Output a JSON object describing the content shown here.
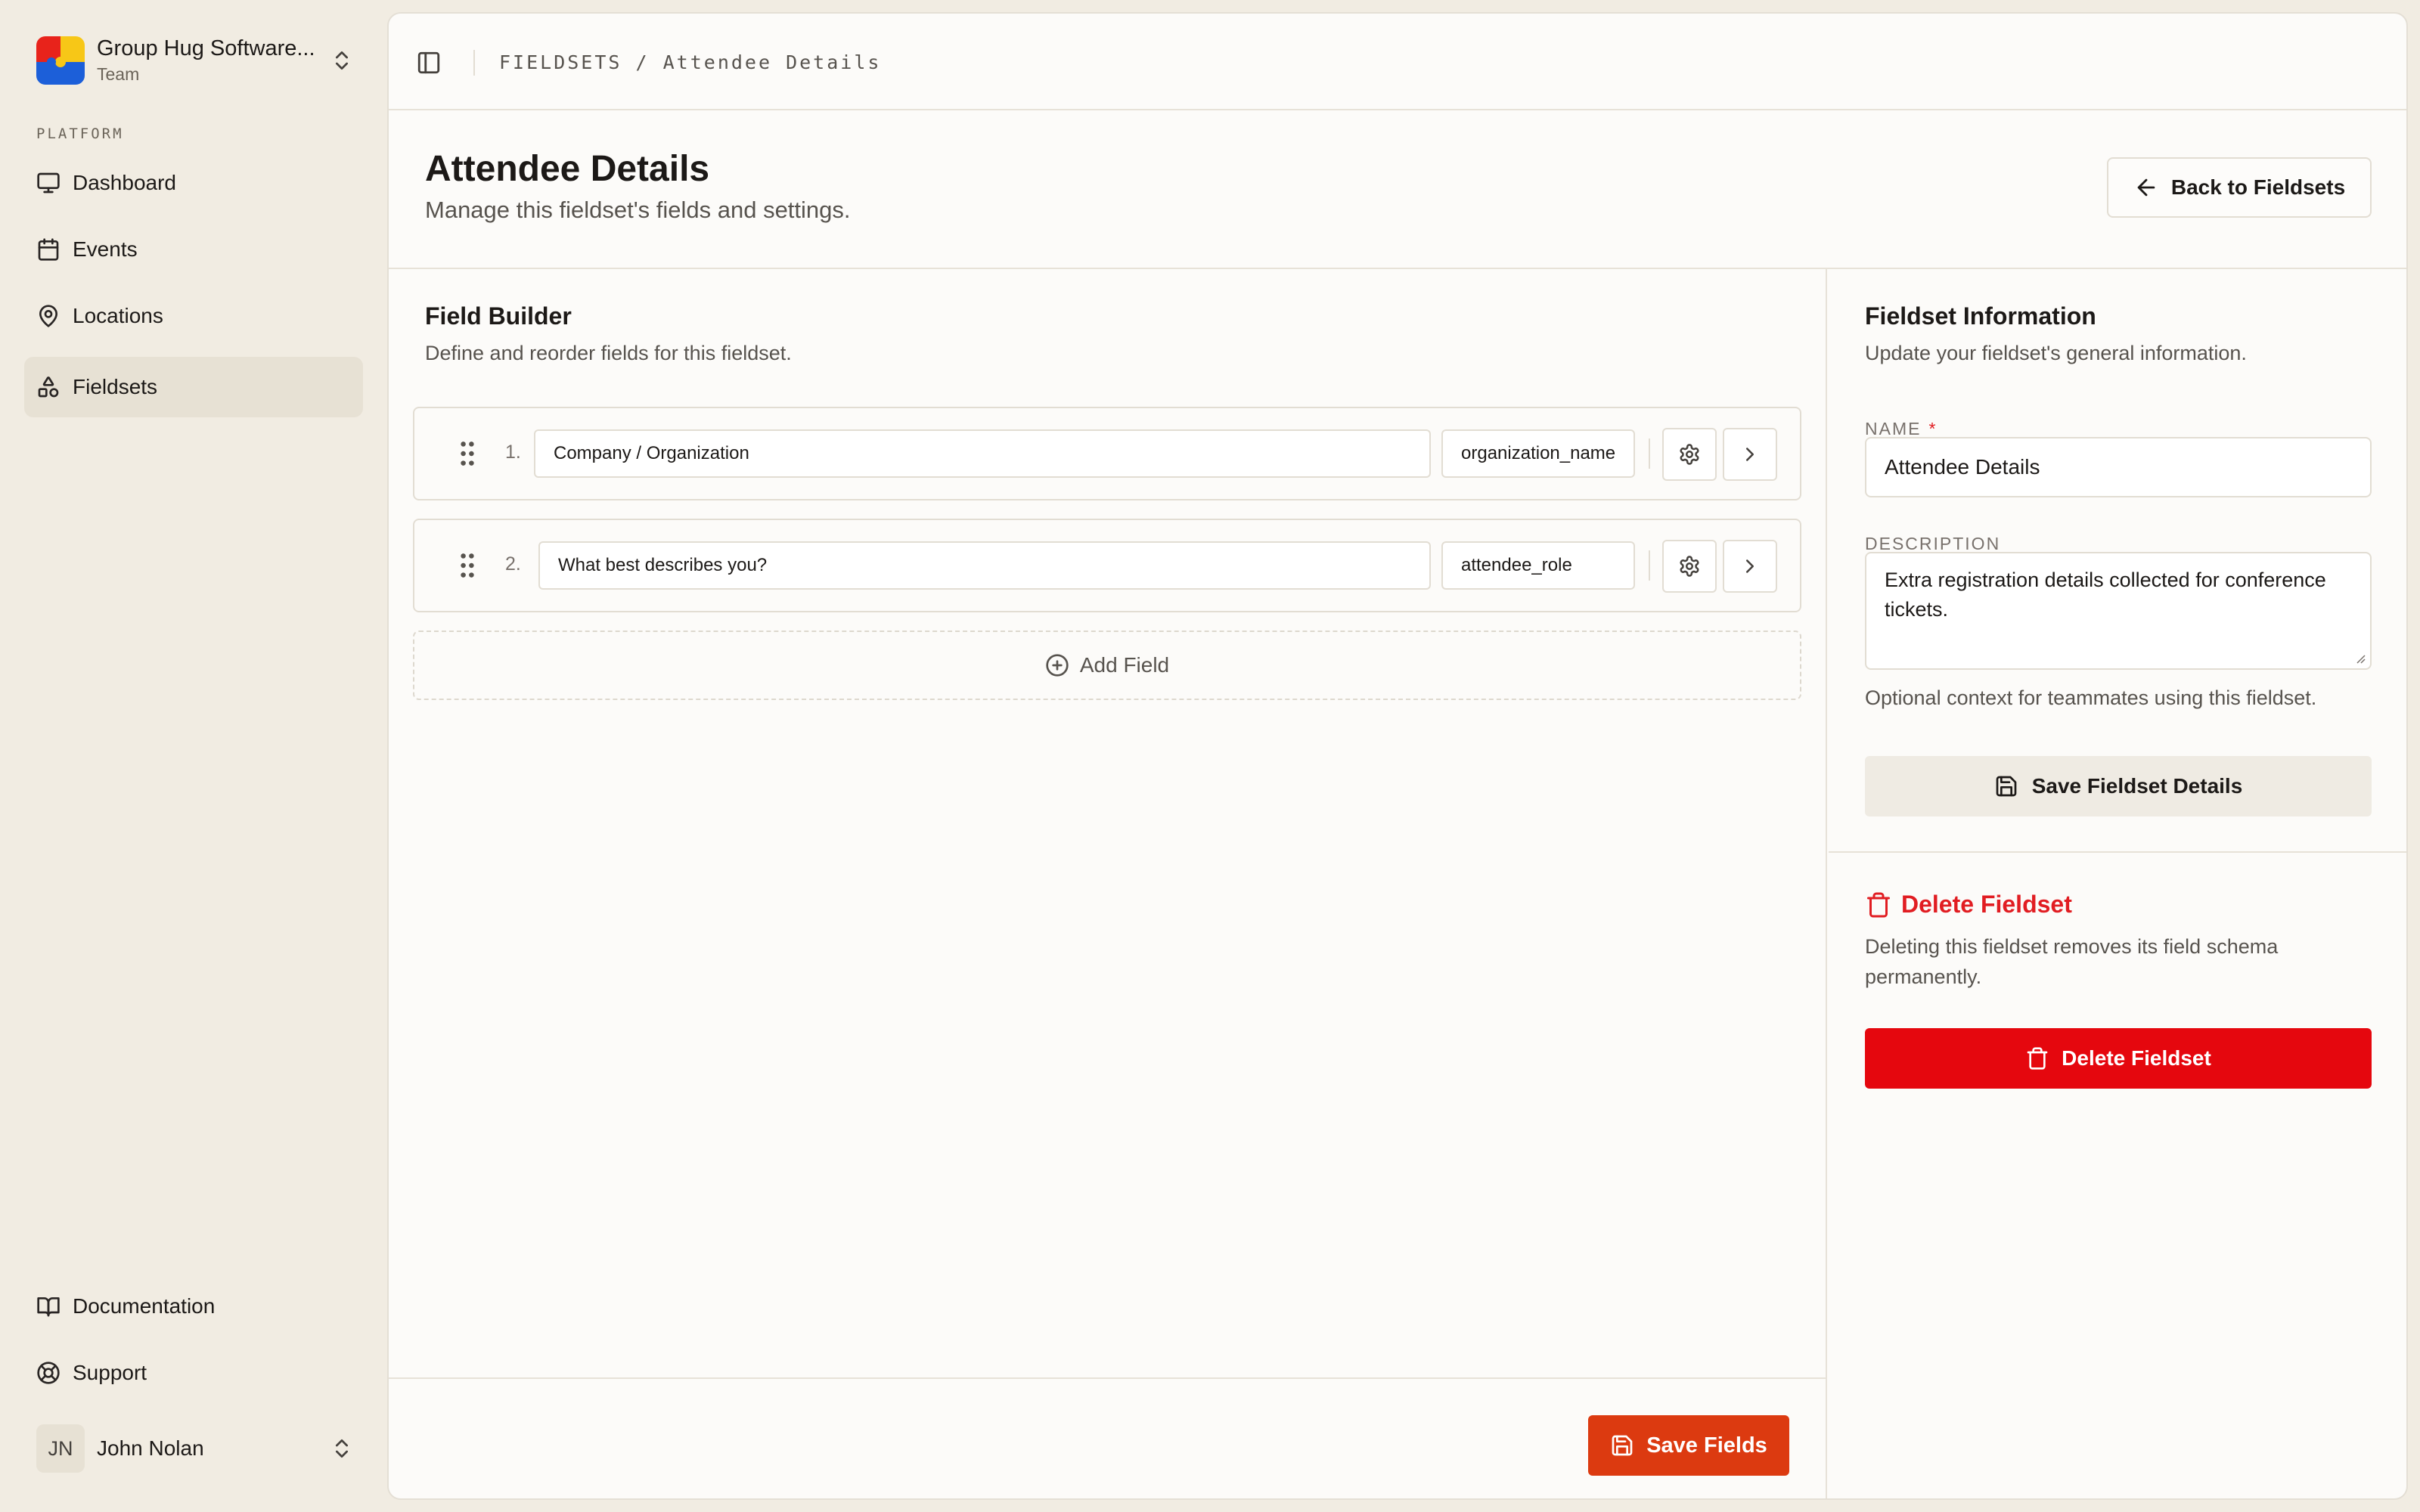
{
  "team": {
    "name": "Group Hug Software...",
    "plan": "Team",
    "logo_icon": "team-logo"
  },
  "sidebar": {
    "section_label": "PLATFORM",
    "items": [
      {
        "label": "Dashboard",
        "icon": "monitor-icon"
      },
      {
        "label": "Events",
        "icon": "calendar-icon"
      },
      {
        "label": "Locations",
        "icon": "map-pin-icon"
      },
      {
        "label": "Fieldsets",
        "icon": "shapes-icon",
        "active": true
      }
    ],
    "footer_items": [
      {
        "label": "Documentation",
        "icon": "book-icon"
      },
      {
        "label": "Support",
        "icon": "lifebuoy-icon"
      }
    ]
  },
  "user": {
    "initials": "JN",
    "name": "John Nolan"
  },
  "breadcrumb": {
    "text": "FIELDSETS / Attendee Details"
  },
  "page": {
    "title": "Attendee Details",
    "subtitle": "Manage this fieldset's fields and settings.",
    "back_button": "Back to Fieldsets"
  },
  "builder": {
    "title": "Field Builder",
    "subtitle": "Define and reorder fields for this fieldset.",
    "fields": [
      {
        "number": "1.",
        "label": "Company / Organization",
        "key": "organization_name"
      },
      {
        "number": "2.",
        "label": "What best describes you?",
        "key": "attendee_role"
      }
    ],
    "add_field": "Add Field",
    "save_button": "Save Fields"
  },
  "info": {
    "title": "Fieldset Information",
    "subtitle": "Update your fieldset's general information.",
    "name_label": "NAME",
    "name_required": "*",
    "name_value": "Attendee Details",
    "description_label": "DESCRIPTION",
    "description_value": "Extra registration details collected for conference tickets.",
    "description_hint": "Optional context for teammates using this fieldset.",
    "save_button": "Save Fieldset Details"
  },
  "danger": {
    "title": "Delete Fieldset",
    "text": "Deleting this fieldset removes its field schema permanently.",
    "button": "Delete Fieldset"
  },
  "colors": {
    "sidebar_bg": "#f1ece2",
    "accent_orange": "#dc3a10",
    "danger_red": "#e5070e",
    "active_nav_bg": "#e7e1d4"
  }
}
